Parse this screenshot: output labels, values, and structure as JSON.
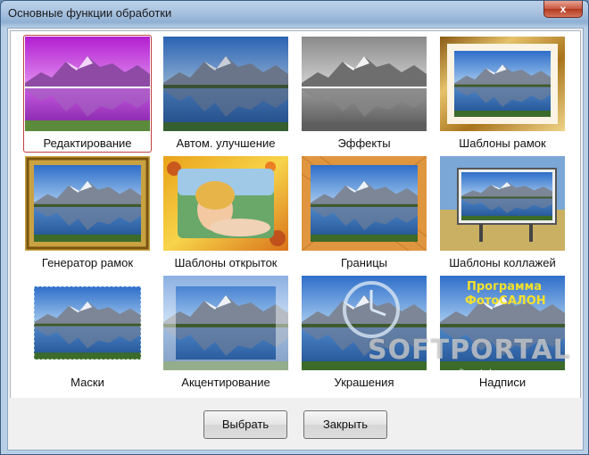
{
  "window": {
    "title": "Основные функции обработки",
    "close_glyph": "x"
  },
  "tiles": [
    {
      "label": "Редактирование",
      "selected": true
    },
    {
      "label": "Автом. улучшение"
    },
    {
      "label": "Эффекты"
    },
    {
      "label": "Шаблоны рамок"
    },
    {
      "label": "Генератор рамок"
    },
    {
      "label": "Шаблоны открыток"
    },
    {
      "label": "Границы"
    },
    {
      "label": "Шаблоны коллажей"
    },
    {
      "label": "Маски"
    },
    {
      "label": "Акцентирование"
    },
    {
      "label": "Украшения"
    },
    {
      "label": "Надписи"
    }
  ],
  "inscription": {
    "line1": "Программа",
    "line2": "ФотоСАЛОН"
  },
  "buttons": {
    "select": "Выбрать",
    "close": "Закрыть"
  },
  "watermark": {
    "brand": "SOFTPORTAL",
    "site": "www.softportal.com"
  }
}
